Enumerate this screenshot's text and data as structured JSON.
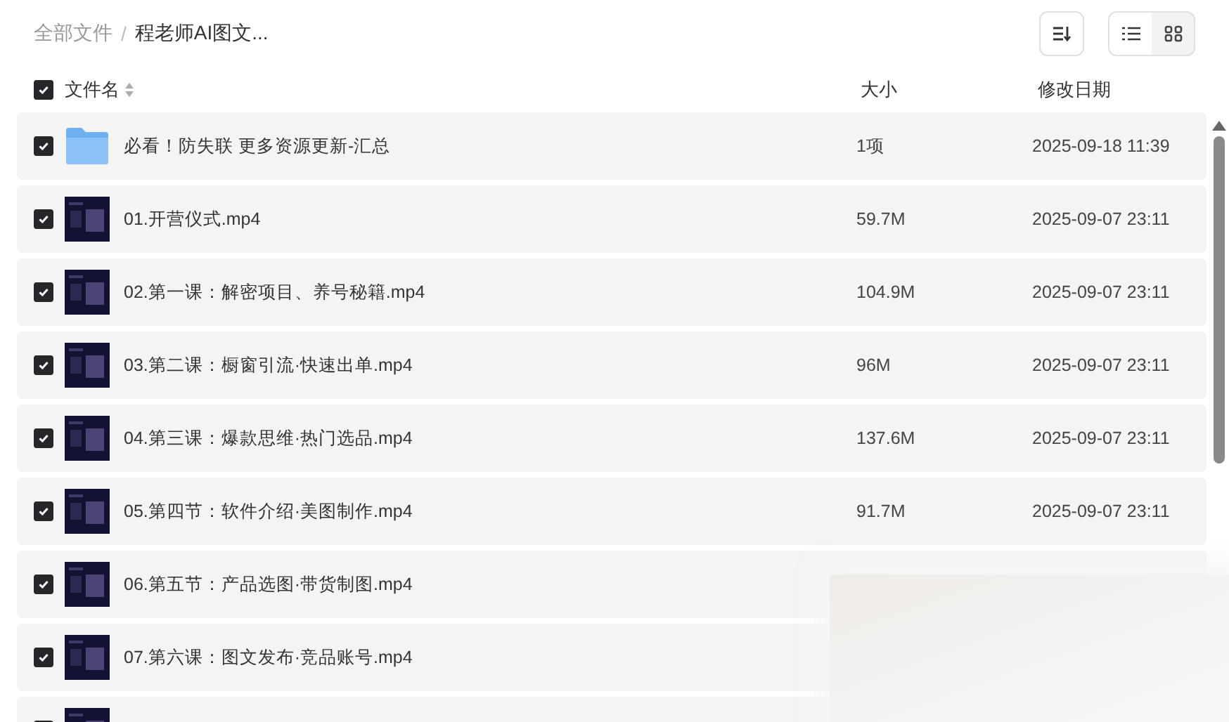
{
  "breadcrumb": {
    "separator": "/",
    "items": [
      {
        "label": "全部文件",
        "current": false
      },
      {
        "label": "程老师AI图文...",
        "current": true
      }
    ]
  },
  "views": [
    {
      "kind": "list",
      "selected": true
    },
    {
      "kind": "grid",
      "selected": false
    }
  ],
  "header": {
    "checked": true,
    "columns": [
      "文件名",
      "大小",
      "修改日期"
    ]
  },
  "rows": [
    {
      "kind": "folder",
      "checked": true,
      "name": "必看！防失联 更多资源更新-汇总",
      "size": "1项",
      "date": "2025-09-18 11:39"
    },
    {
      "kind": "video",
      "checked": true,
      "name": "01.开营仪式.mp4",
      "size": "59.7M",
      "date": "2025-09-07 23:11"
    },
    {
      "kind": "video",
      "checked": true,
      "name": "02.第一课：解密项目、养号秘籍.mp4",
      "size": "104.9M",
      "date": "2025-09-07 23:11"
    },
    {
      "kind": "video",
      "checked": true,
      "name": "03.第二课：橱窗引流·快速出单.mp4",
      "size": "96M",
      "date": "2025-09-07 23:11"
    },
    {
      "kind": "video",
      "checked": true,
      "name": "04.第三课：爆款思维·热门选品.mp4",
      "size": "137.6M",
      "date": "2025-09-07 23:11"
    },
    {
      "kind": "video",
      "checked": true,
      "name": "05.第四节：软件介绍·美图制作.mp4",
      "size": "91.7M",
      "date": "2025-09-07 23:11"
    },
    {
      "kind": "video",
      "checked": true,
      "name": "06.第五节：产品选图·带货制图.mp4"
    },
    {
      "kind": "video",
      "checked": true,
      "name": "07.第六课：图文发布·竞品账号.mp4"
    },
    {
      "kind": "video",
      "checked": true
    }
  ]
}
